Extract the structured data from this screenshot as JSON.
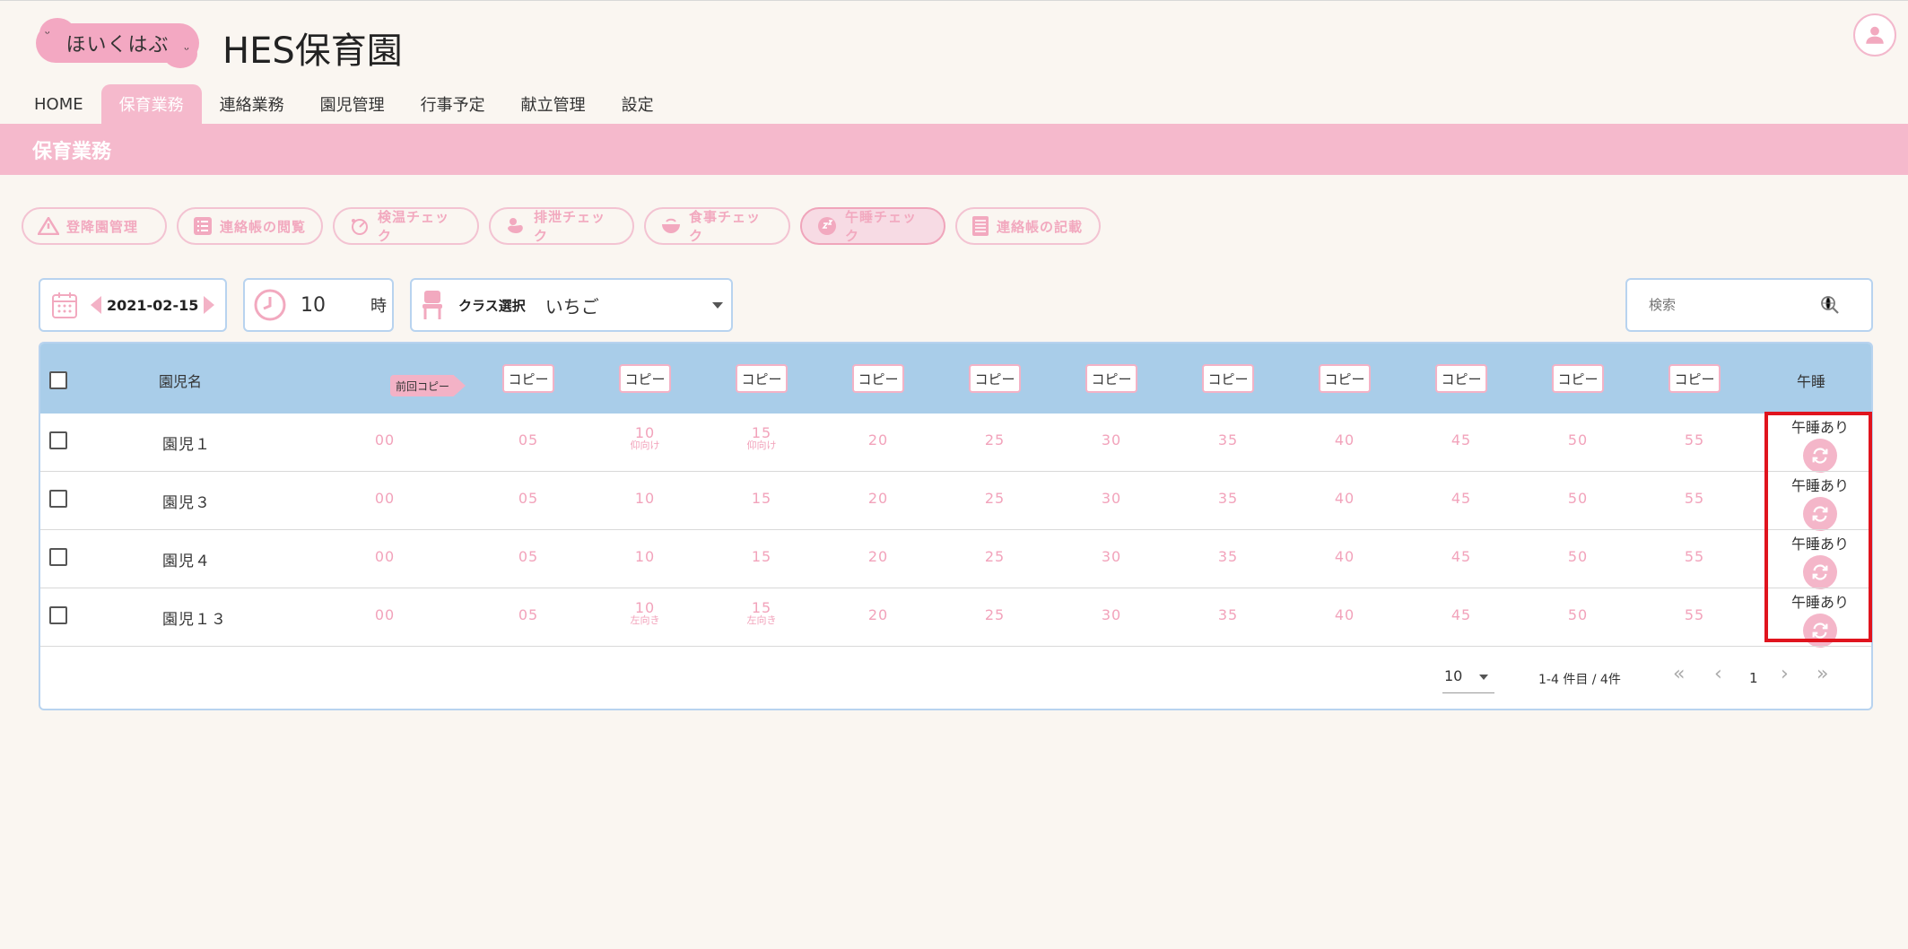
{
  "header": {
    "logo_text": "ほいくはぶ",
    "title": "HES保育園"
  },
  "nav": {
    "tabs": [
      "HOME",
      "保育業務",
      "連絡業務",
      "園児管理",
      "行事予定",
      "献立管理",
      "設定"
    ],
    "active_tab": "保育業務"
  },
  "section_title": "保育業務",
  "function_buttons": [
    {
      "label": "登降園管理",
      "icon": "warning-triangle-icon"
    },
    {
      "label": "連絡帳の閲覧",
      "icon": "list-icon"
    },
    {
      "label": "検温チェック",
      "icon": "thermometer-icon"
    },
    {
      "label": "排泄チェック",
      "icon": "duck-icon"
    },
    {
      "label": "食事チェック",
      "icon": "bowl-icon"
    },
    {
      "label": "午睡チェック",
      "icon": "sleep-icon"
    },
    {
      "label": "連絡帳の記載",
      "icon": "notebook-icon"
    }
  ],
  "active_function": "午睡チェック",
  "controls": {
    "date": "2021-02-15",
    "hour": "10",
    "hour_unit": "時",
    "class_label": "クラス選択",
    "class_value": "いちご",
    "search_placeholder": "検索"
  },
  "table": {
    "name_header": "園児名",
    "copy_prev_label": "前回コピー",
    "copy_label": "コピー",
    "nap_header": "午睡",
    "rows": [
      {
        "name": "園児１",
        "nap_status": "午睡あり",
        "slots": [
          {
            "time": "00"
          },
          {
            "time": "05"
          },
          {
            "time": "10",
            "status": "仰向け"
          },
          {
            "time": "15",
            "status": "仰向け"
          },
          {
            "time": "20"
          },
          {
            "time": "25"
          },
          {
            "time": "30"
          },
          {
            "time": "35"
          },
          {
            "time": "40"
          },
          {
            "time": "45"
          },
          {
            "time": "50"
          },
          {
            "time": "55"
          }
        ]
      },
      {
        "name": "園児３",
        "nap_status": "午睡あり",
        "slots": [
          {
            "time": "00"
          },
          {
            "time": "05"
          },
          {
            "time": "10"
          },
          {
            "time": "15"
          },
          {
            "time": "20"
          },
          {
            "time": "25"
          },
          {
            "time": "30"
          },
          {
            "time": "35"
          },
          {
            "time": "40"
          },
          {
            "time": "45"
          },
          {
            "time": "50"
          },
          {
            "time": "55"
          }
        ]
      },
      {
        "name": "園児４",
        "nap_status": "午睡あり",
        "slots": [
          {
            "time": "00"
          },
          {
            "time": "05"
          },
          {
            "time": "10"
          },
          {
            "time": "15"
          },
          {
            "time": "20"
          },
          {
            "time": "25"
          },
          {
            "time": "30"
          },
          {
            "time": "35"
          },
          {
            "time": "40"
          },
          {
            "time": "45"
          },
          {
            "time": "50"
          },
          {
            "time": "55"
          }
        ]
      },
      {
        "name": "園児１３",
        "nap_status": "午睡あり",
        "slots": [
          {
            "time": "00"
          },
          {
            "time": "05"
          },
          {
            "time": "10",
            "status": "左向き"
          },
          {
            "time": "15",
            "status": "左向き"
          },
          {
            "time": "20"
          },
          {
            "time": "25"
          },
          {
            "time": "30"
          },
          {
            "time": "35"
          },
          {
            "time": "40"
          },
          {
            "time": "45"
          },
          {
            "time": "50"
          },
          {
            "time": "55"
          }
        ]
      }
    ]
  },
  "pagination": {
    "page_size": "10",
    "range_text": "1-4 件目 / 4件",
    "current_page": "1"
  },
  "colors": {
    "accent_pink": "#f5b9cc",
    "header_blue": "#a9cde9",
    "highlight_red": "#e0141e"
  }
}
